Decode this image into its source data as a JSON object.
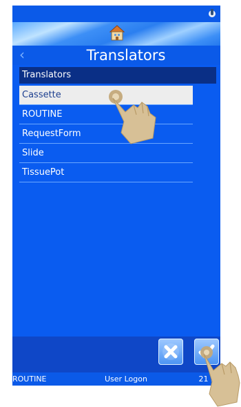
{
  "header": {
    "title": "Translators",
    "back_icon": "chevron-left-icon",
    "home_icon": "home-icon"
  },
  "status_icon": "device-status-icon",
  "list": {
    "header": "Translators",
    "items": [
      {
        "label": "Cassette",
        "selected": true
      },
      {
        "label": "ROUTINE",
        "selected": false
      },
      {
        "label": "RequestForm",
        "selected": false
      },
      {
        "label": "Slide",
        "selected": false
      },
      {
        "label": "TissuePot",
        "selected": false
      }
    ]
  },
  "actions": {
    "cancel_icon": "close-icon",
    "confirm_icon": "checkmark-icon"
  },
  "footer": {
    "left": "ROUTINE",
    "center": "User Logon",
    "right": "21 39"
  },
  "colors": {
    "background": "#0a5cf0",
    "list_header": "#0a2f86",
    "selected_row": "#ededed",
    "bottom_panel": "#0f47c7"
  }
}
